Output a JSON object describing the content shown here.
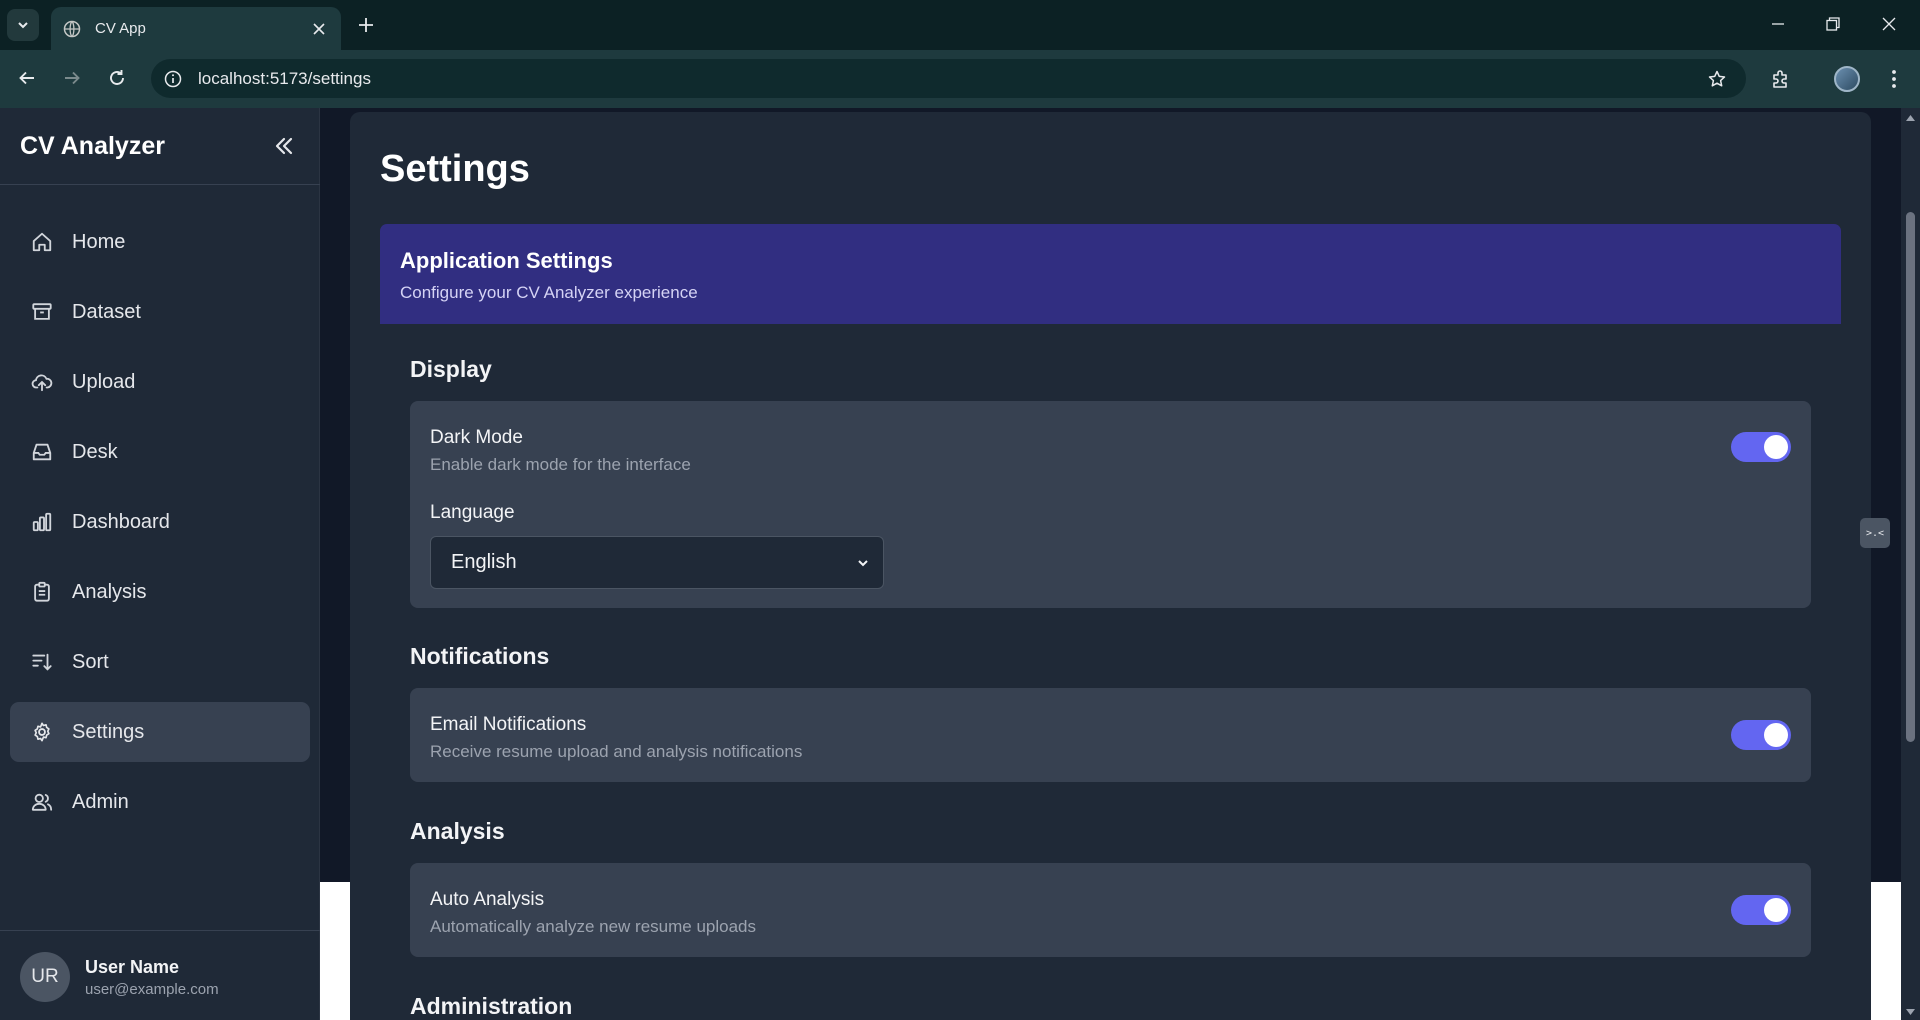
{
  "browser": {
    "tab_title": "CV App",
    "url": "localhost:5173/settings"
  },
  "sidebar": {
    "brand": "CV Analyzer",
    "items": [
      {
        "label": "Home",
        "icon": "home-icon"
      },
      {
        "label": "Dataset",
        "icon": "archive-icon"
      },
      {
        "label": "Upload",
        "icon": "cloud-upload-icon"
      },
      {
        "label": "Desk",
        "icon": "inbox-icon"
      },
      {
        "label": "Dashboard",
        "icon": "bar-chart-icon"
      },
      {
        "label": "Analysis",
        "icon": "clipboard-icon"
      },
      {
        "label": "Sort",
        "icon": "sort-icon"
      },
      {
        "label": "Settings",
        "icon": "gear-icon",
        "active": true
      },
      {
        "label": "Admin",
        "icon": "users-icon"
      }
    ],
    "user": {
      "initials": "UR",
      "name": "User Name",
      "email": "user@example.com"
    }
  },
  "main": {
    "title": "Settings",
    "banner": {
      "title": "Application Settings",
      "subtitle": "Configure your CV Analyzer experience"
    },
    "sections": {
      "display": {
        "title": "Display",
        "dark_mode": {
          "label": "Dark Mode",
          "description": "Enable dark mode for the interface",
          "enabled": true
        },
        "language": {
          "label": "Language",
          "value": "English"
        }
      },
      "notifications": {
        "title": "Notifications",
        "email": {
          "label": "Email Notifications",
          "description": "Receive resume upload and analysis notifications",
          "enabled": true
        }
      },
      "analysis": {
        "title": "Analysis",
        "auto": {
          "label": "Auto Analysis",
          "description": "Automatically analyze new resume uploads",
          "enabled": true
        }
      },
      "administration": {
        "title": "Administration"
      }
    }
  },
  "extension_badge": ">.<",
  "colors": {
    "accent": "#6366f1",
    "banner": "#312e81",
    "sidebar": "#1f2937",
    "card": "#374151"
  }
}
